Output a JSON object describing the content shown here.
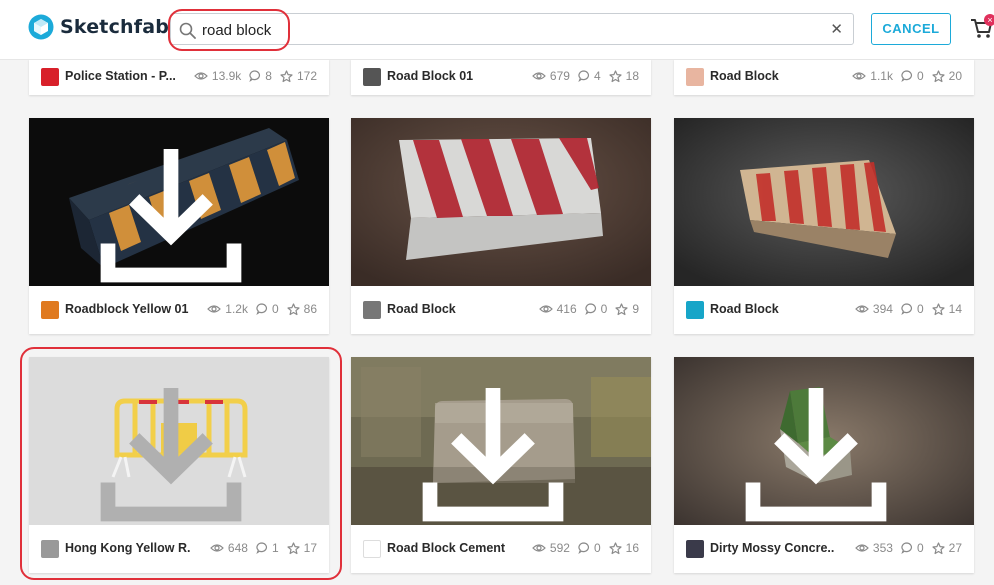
{
  "app": {
    "name": "Sketchfab"
  },
  "search": {
    "value": "road block",
    "placeholder": ""
  },
  "header": {
    "cancel_label": "CANCEL",
    "cart_badge": "×"
  },
  "cards": [
    {
      "title": "Police Station - P...",
      "views": "13.9k",
      "comments": "8",
      "likes": "172"
    },
    {
      "title": "Road Block 01",
      "views": "679",
      "comments": "4",
      "likes": "18"
    },
    {
      "title": "Road Block",
      "views": "1.1k",
      "comments": "0",
      "likes": "20"
    },
    {
      "title": "Roadblock Yellow 01",
      "views": "1.2k",
      "comments": "0",
      "likes": "86"
    },
    {
      "title": "Road Block",
      "views": "416",
      "comments": "0",
      "likes": "9"
    },
    {
      "title": "Road Block",
      "views": "394",
      "comments": "0",
      "likes": "14"
    },
    {
      "title": "Hong Kong Yellow R...",
      "views": "648",
      "comments": "1",
      "likes": "17"
    },
    {
      "title": "Road Block Cement",
      "views": "592",
      "comments": "0",
      "likes": "16"
    },
    {
      "title": "Dirty Mossy Concre...",
      "views": "353",
      "comments": "0",
      "likes": "27"
    }
  ],
  "colors": {
    "accent": "#1caad9",
    "highlight": "#e0303a",
    "logo": "#1caad9"
  }
}
